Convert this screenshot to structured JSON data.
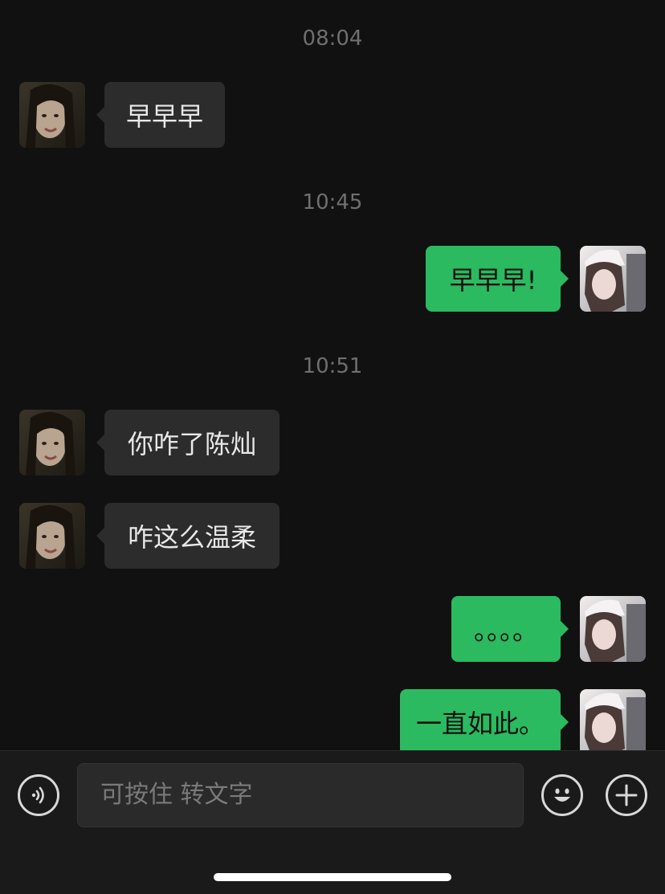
{
  "messages": {
    "time_1": "08:04",
    "msg_1": "早早早",
    "time_2": "10:45",
    "msg_2": "早早早!",
    "time_3": "10:51",
    "msg_3": "你咋了陈灿",
    "msg_4": "咋这么温柔",
    "msg_5": "。。。。",
    "msg_6": "一直如此。"
  },
  "input_bar": {
    "placeholder": "可按住 转文字",
    "voice_icon": "voice-icon",
    "emoji_icon": "emoji-icon",
    "plus_icon": "plus-icon"
  },
  "colors": {
    "background": "#111111",
    "incoming_bubble": "#2c2c2c",
    "outgoing_bubble": "#2bba60"
  }
}
